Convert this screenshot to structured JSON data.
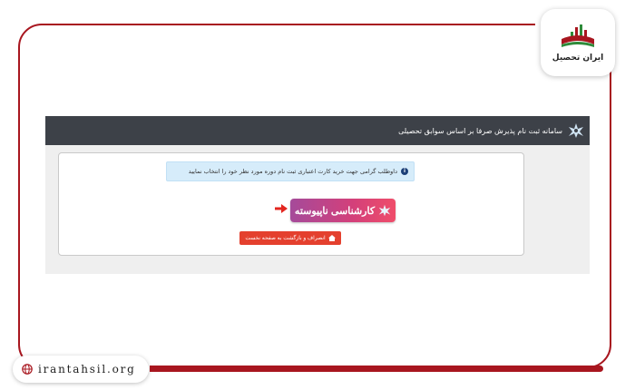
{
  "logo": {
    "brand_text": "ایران تحصیل",
    "icon": "book-chart-logo-icon"
  },
  "website": {
    "url": "irantahsil.org",
    "icon": "globe-icon"
  },
  "app": {
    "header_title": "سامانه ثبت نام پذیرش صرفا بر اساس سوابق تحصیلی",
    "header_icon": "university-emblem-icon",
    "info_text": "داوطلب گرامی جهت خرید کارت اعتباری ثبت نام دوره مورد نظر خود را انتخاب نمایید",
    "info_icon": "info-icon",
    "main_button_label": "کارشناسی ناپیوسته",
    "back_button_label": "انصراف و بازگشت به صفحه نخست",
    "back_button_icon": "home-icon",
    "pointer_icon": "arrow-right-icon"
  },
  "colors": {
    "brand_red": "#a8161f",
    "header_bg": "#3d4148",
    "info_bg": "#d6ecfa",
    "button_gradient_start": "#a54a9a",
    "button_gradient_end": "#ef4d6a",
    "back_button": "#e4402e"
  }
}
